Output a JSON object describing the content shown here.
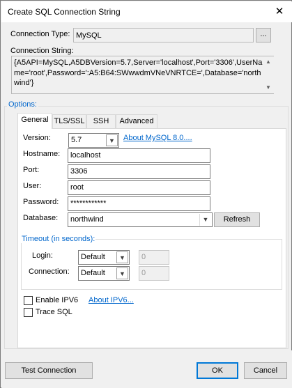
{
  "window": {
    "title": "Create SQL Connection String",
    "close_glyph": "✕"
  },
  "connection_type": {
    "label": "Connection Type:",
    "value": "MySQL",
    "browse_label": "..."
  },
  "connection_string": {
    "label": "Connection String:",
    "value": "{A5API=MySQL,A5DBVersion=5.7,Server='localhost',Port='3306',UserName='root',Password=':A5:B64:SWwwdmVNeVNRTCE=',Database='northwind'}"
  },
  "options": {
    "label": "Options:",
    "tabs": [
      {
        "label": "General",
        "active": true
      },
      {
        "label": "TLS/SSL",
        "active": false
      },
      {
        "label": "SSH",
        "active": false
      },
      {
        "label": "Advanced",
        "active": false
      }
    ],
    "general": {
      "version_label": "Version:",
      "version_value": "5.7",
      "about_mysql_link": "About MySQL 8.0....",
      "hostname_label": "Hostname:",
      "hostname_value": "localhost",
      "port_label": "Port:",
      "port_value": "3306",
      "user_label": "User:",
      "user_value": "root",
      "password_label": "Password:",
      "password_value": "************",
      "database_label": "Database:",
      "database_value": "northwind",
      "refresh_label": "Refresh",
      "timeout": {
        "label": "Timeout (in seconds):",
        "login_label": "Login:",
        "login_value": "Default",
        "login_number": "0",
        "connection_label": "Connection:",
        "connection_value": "Default",
        "connection_number": "0"
      },
      "enable_ipv6_label": "Enable IPV6",
      "enable_ipv6_checked": false,
      "about_ipv6_link": "About IPV6...",
      "trace_sql_label": "Trace SQL",
      "trace_sql_checked": false
    }
  },
  "buttons": {
    "test_connection": "Test Connection",
    "ok": "OK",
    "cancel": "Cancel"
  },
  "colors": {
    "link": "#0066cc",
    "window_bg": "#f0f0f0",
    "default_button_border": "#0078d7"
  },
  "icons": {
    "dropdown": "chevron-down-icon",
    "scroll_up": "scroll-up-arrow-icon",
    "scroll_down": "scroll-down-arrow-icon",
    "close": "close-icon"
  }
}
